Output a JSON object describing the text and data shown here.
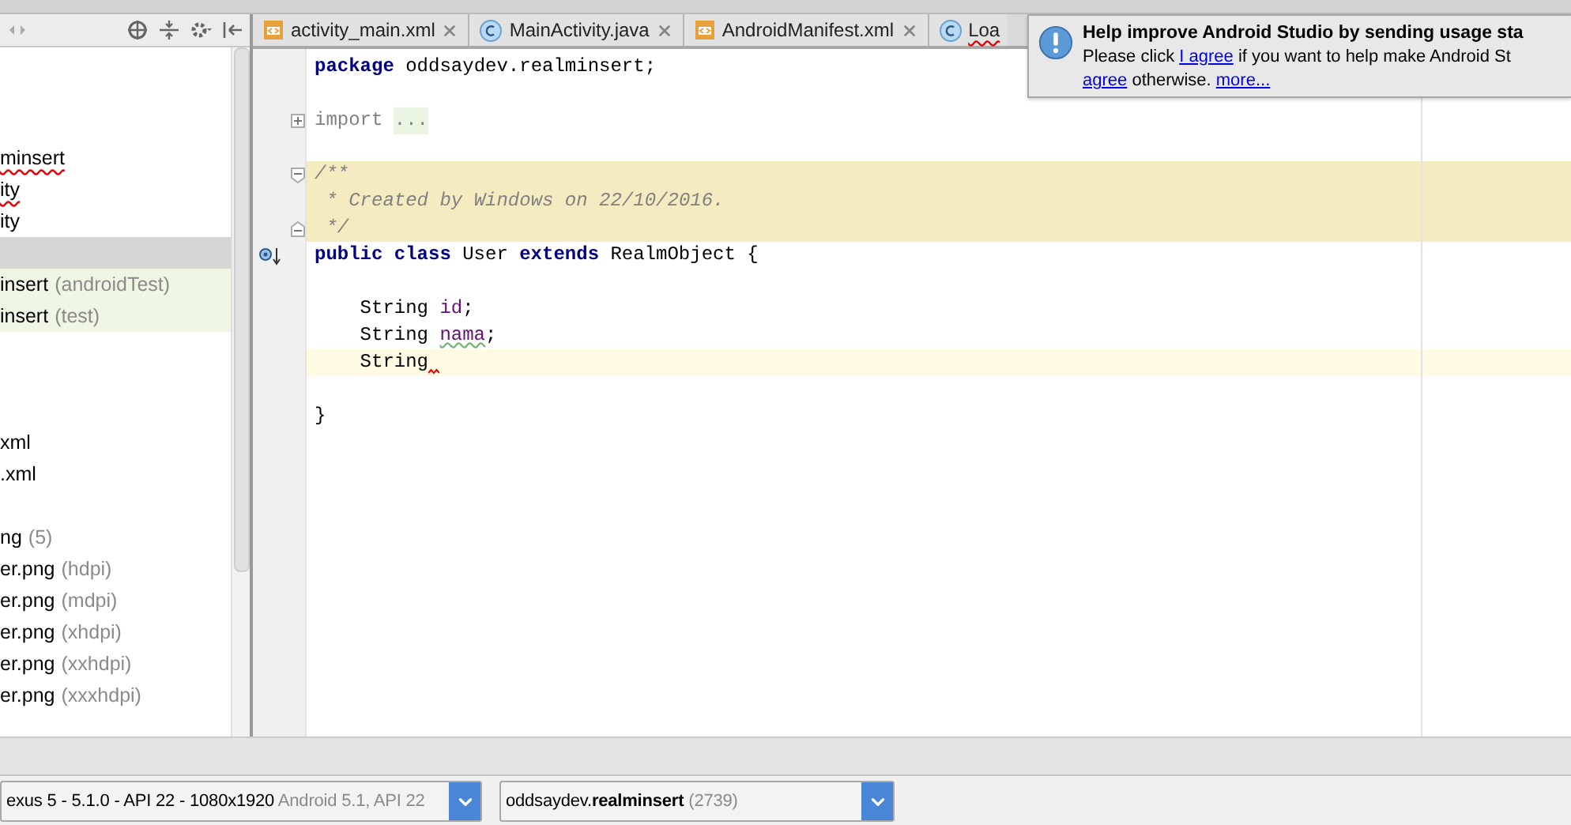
{
  "project_tree": {
    "items": [
      {
        "kind": "blank",
        "selected": false
      },
      {
        "kind": "blank",
        "selected": false
      },
      {
        "kind": "blank",
        "selected": false
      },
      {
        "kind": "node",
        "label": "minsert",
        "error": true,
        "selected": false
      },
      {
        "kind": "node",
        "label": "ity",
        "error": true,
        "selected": false
      },
      {
        "kind": "node",
        "label": "ity",
        "error": false,
        "selected": false
      },
      {
        "kind": "blank",
        "selected": true
      },
      {
        "kind": "test",
        "label": "insert",
        "detail": "(androidTest)",
        "error": false,
        "selected": false
      },
      {
        "kind": "test",
        "label": "insert",
        "detail": "(test)",
        "error": false,
        "selected": false
      },
      {
        "kind": "blank",
        "selected": false
      },
      {
        "kind": "blank",
        "selected": false
      },
      {
        "kind": "blank",
        "selected": false
      },
      {
        "kind": "node",
        "label": "xml",
        "error": false,
        "selected": false
      },
      {
        "kind": "node",
        "label": ".xml",
        "error": false,
        "selected": false
      },
      {
        "kind": "blank",
        "selected": false
      },
      {
        "kind": "node",
        "label": "ng",
        "detail": "(5)",
        "error": false,
        "selected": false
      },
      {
        "kind": "node",
        "label": "er.png",
        "detail": "(hdpi)",
        "error": false,
        "selected": false
      },
      {
        "kind": "node",
        "label": "er.png",
        "detail": "(mdpi)",
        "error": false,
        "selected": false
      },
      {
        "kind": "node",
        "label": "er.png",
        "detail": "(xhdpi)",
        "error": false,
        "selected": false
      },
      {
        "kind": "node",
        "label": "er.png",
        "detail": "(xxhdpi)",
        "error": false,
        "selected": false
      },
      {
        "kind": "node",
        "label": "er.png",
        "detail": "(xxxhdpi)",
        "error": false,
        "selected": false
      }
    ]
  },
  "editor_tabs": [
    {
      "kind": "xml",
      "label": "activity_main.xml",
      "error": false
    },
    {
      "kind": "class",
      "label": "MainActivity.java",
      "error": false
    },
    {
      "kind": "xml",
      "label": "AndroidManifest.xml",
      "error": false
    },
    {
      "kind": "class",
      "label": "Loa",
      "error": true
    }
  ],
  "code_lines": [
    {
      "kind": "code",
      "tokens": [
        {
          "kind": "keyword",
          "text": "package"
        },
        {
          "kind": "plain",
          "text": "oddsaydev.realminsert;"
        }
      ]
    },
    {
      "kind": "blank"
    },
    {
      "kind": "code",
      "marker": {
        "kind": "fold-expand"
      },
      "tokens": [
        {
          "kind": "import",
          "text": "import"
        },
        {
          "kind": "folded",
          "text": "..."
        }
      ]
    },
    {
      "kind": "blank"
    },
    {
      "kind": "doc",
      "marker": {
        "kind": "fold-start"
      },
      "tokens": [
        {
          "kind": "comment",
          "text": "/**"
        }
      ]
    },
    {
      "kind": "doc",
      "tokens": [
        {
          "kind": "comment",
          "text": " * Created by Windows on 22/10/2016."
        }
      ]
    },
    {
      "kind": "doc",
      "marker": {
        "kind": "fold-end"
      },
      "tokens": [
        {
          "kind": "comment",
          "text": " */"
        }
      ]
    },
    {
      "kind": "code",
      "marker": {
        "kind": "implemented"
      },
      "tokens": [
        {
          "kind": "keyword",
          "text": "public class"
        },
        {
          "kind": "plain",
          "text": "User"
        },
        {
          "kind": "keyword",
          "text": "extends"
        },
        {
          "kind": "plain",
          "text": "RealmObject {"
        }
      ]
    },
    {
      "kind": "blank"
    },
    {
      "kind": "code",
      "tokens": [
        {
          "kind": "indent",
          "text": "String"
        },
        {
          "kind": "field",
          "text": "id"
        },
        {
          "kind": "tight",
          "text": ";"
        }
      ]
    },
    {
      "kind": "code",
      "tokens": [
        {
          "kind": "indent",
          "text": "String"
        },
        {
          "kind": "typo",
          "text": "nama"
        },
        {
          "kind": "tight",
          "text": ";"
        }
      ]
    },
    {
      "kind": "current",
      "error": true,
      "tokens": [
        {
          "kind": "indent",
          "text": "String"
        }
      ]
    },
    {
      "kind": "blank"
    },
    {
      "kind": "code",
      "tokens": [
        {
          "kind": "plain",
          "text": "}"
        }
      ]
    }
  ],
  "notification": {
    "title": "Help improve Android Studio by sending usage sta",
    "lines": [
      [
        {
          "kind": "text",
          "text": "Please click "
        },
        {
          "kind": "link",
          "text": "I agree"
        },
        {
          "kind": "text",
          "text": " if you want to help make Android St"
        }
      ],
      [
        {
          "kind": "link",
          "text": "agree"
        },
        {
          "kind": "text",
          "text": " otherwise. "
        },
        {
          "kind": "link",
          "text": "more..."
        }
      ]
    ]
  },
  "run_bar": {
    "device": {
      "text": "exus 5 - 5.1.0 - API 22 - 1080x1920",
      "detail": "Android 5.1, API 22"
    },
    "process": {
      "text": "oddsaydev.**realminsert**",
      "detail": "(2739)"
    }
  }
}
